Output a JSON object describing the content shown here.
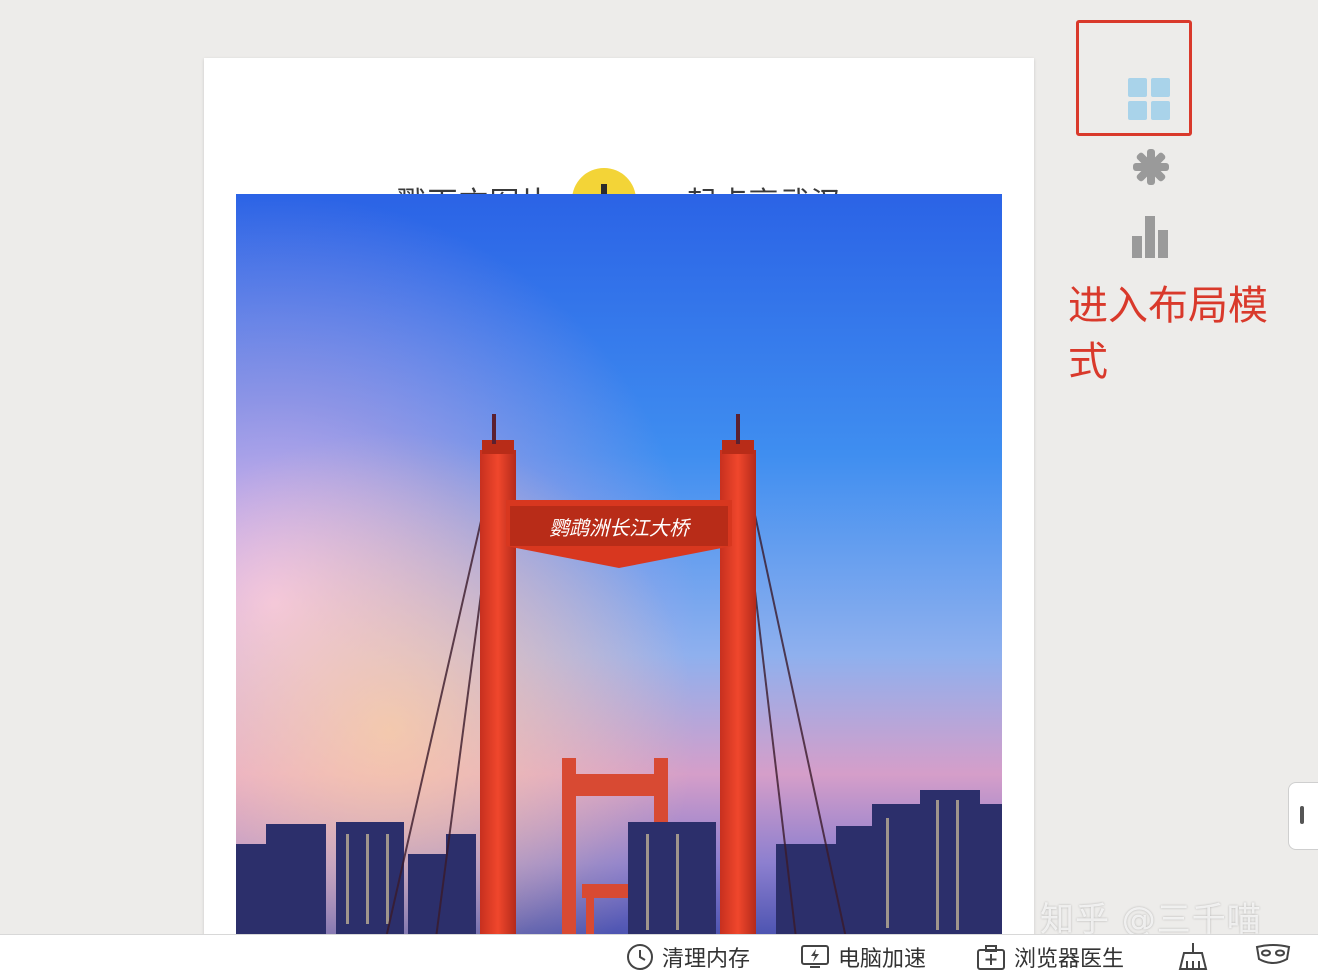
{
  "card": {
    "headline_before": "戳下方图片",
    "headline_after": "一起点亮武汉",
    "arrow_icon": "arrow-down-icon",
    "arrow_circle_color": "#f3d437",
    "photo": {
      "description_icon": "bridge-photo",
      "sign_text": "鹦鹉洲长江大桥"
    }
  },
  "side_tools": {
    "items": [
      {
        "name": "layout-grid-icon",
        "highlighted": true
      },
      {
        "name": "gear-icon",
        "highlighted": false
      },
      {
        "name": "bar-chart-icon",
        "highlighted": false
      }
    ],
    "highlight_color": "#d9392b"
  },
  "annotation": {
    "text": "进入布局模式"
  },
  "watermark": "知乎 @三千喵",
  "statusbar": {
    "items": [
      {
        "label": "清理内存",
        "icon": "clock-icon"
      },
      {
        "label": "电脑加速",
        "icon": "lightning-monitor-icon"
      },
      {
        "label": "浏览器医生",
        "icon": "medical-kit-icon"
      },
      {
        "icon": "broom-icon"
      },
      {
        "icon": "mask-icon"
      }
    ]
  }
}
